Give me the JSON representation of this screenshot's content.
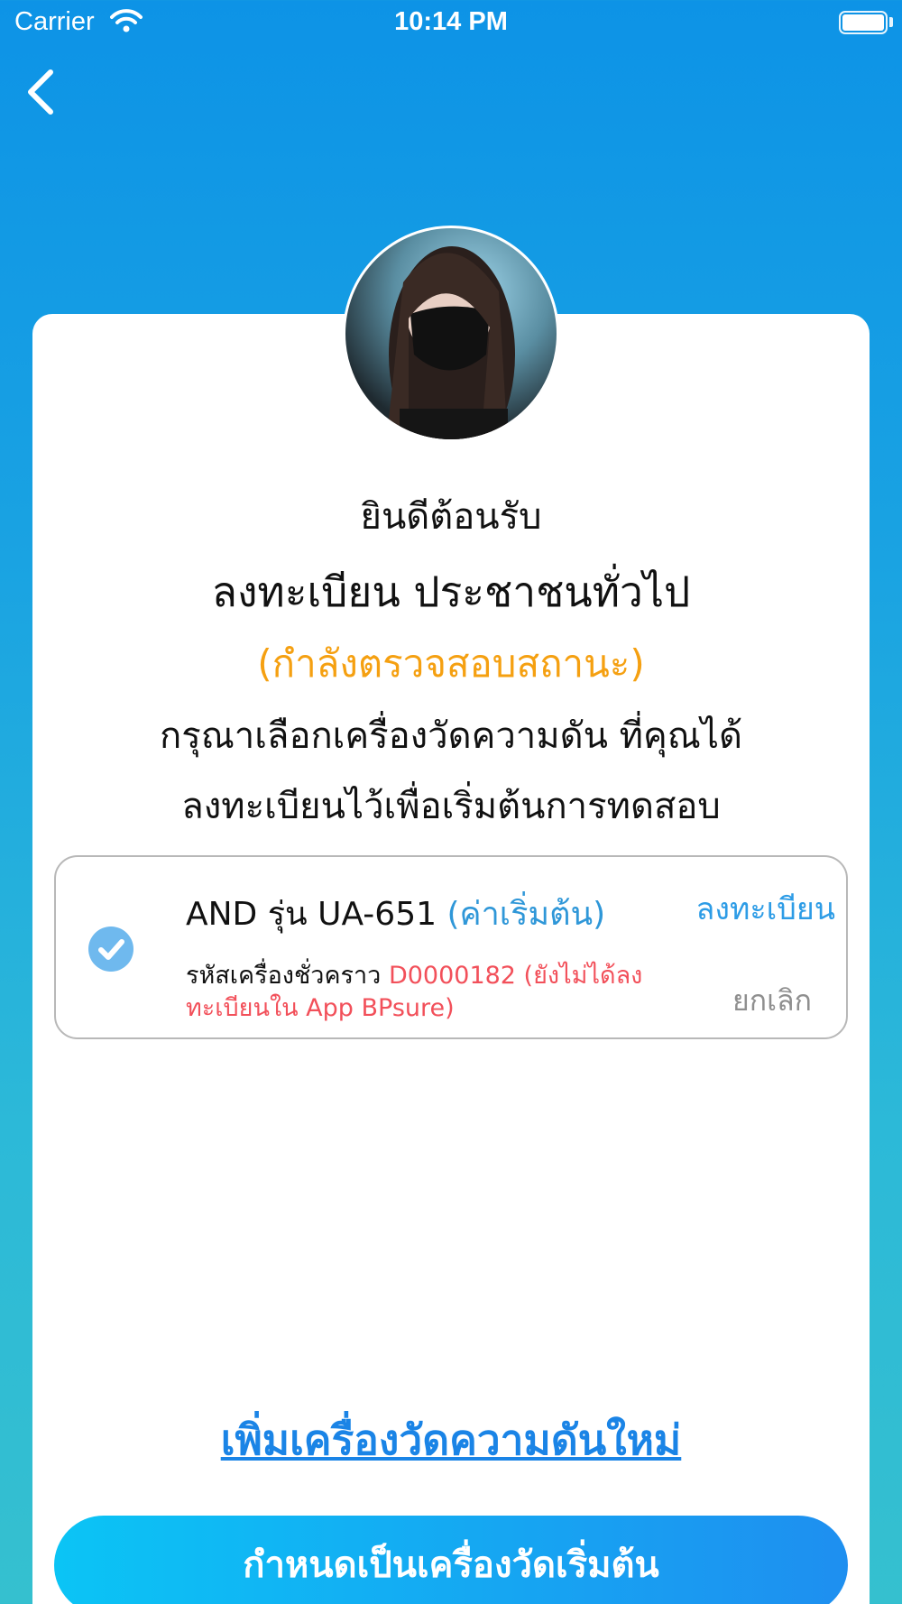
{
  "status_bar": {
    "carrier": "Carrier",
    "time": "10:14 PM"
  },
  "nav": {
    "back_icon": "chevron-left-icon"
  },
  "profile": {
    "welcome": "ยินดีต้อนรับ",
    "register_type": "ลงทะเบียน ประชาชนทั่วไป",
    "status": "(กำลังตรวจสอบสถานะ)",
    "instruction_line1": "กรุณาเลือกเครื่องวัดความดัน ที่คุณได้",
    "instruction_line2": "ลงทะเบียนไว้เพื่อเริ่มต้นการทดสอบ"
  },
  "device": {
    "name": "AND รุ่น UA-651",
    "default_label": "(ค่าเริ่มต้น)",
    "register_label": "ลงทะเบียน",
    "temp_code_label": "รหัสเครื่องชั่วคราว",
    "temp_code_value": "D0000182 (ยังไม่ได้ลงทะเบียนใน App BPsure)",
    "cancel_label": "ยกเลิก",
    "selected": true
  },
  "actions": {
    "add_device": "เพิ่มเครื่องวัดความดันใหม่",
    "set_default": "กำหนดเป็นเครื่องวัดเริ่มต้น"
  },
  "colors": {
    "accent": "#2d9ce6",
    "status_orange": "#f5a011",
    "error_red": "#f2505a",
    "check_blue": "#6fb9ee"
  }
}
